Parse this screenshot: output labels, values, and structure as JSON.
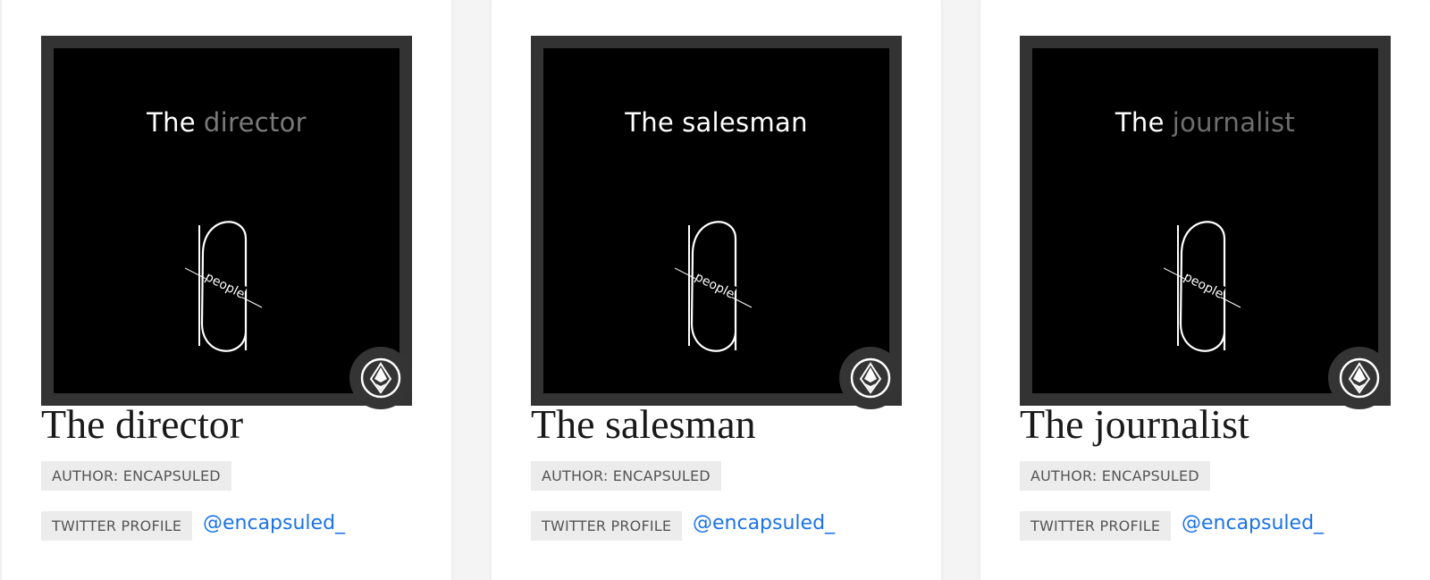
{
  "cards": [
    {
      "art_prefix": "The",
      "art_role": "director",
      "art_role_color": "#7a7a7a",
      "art_word": "people",
      "title": "The director",
      "author_tag": "AUTHOR: ENCAPSULED",
      "twitter_tag": "TWITTER PROFILE",
      "twitter_handle": "@encapsuled_",
      "badge_icon": "ethereum-icon"
    },
    {
      "art_prefix": "The",
      "art_role": "salesman",
      "art_role_color": "#ffffff",
      "art_word": "people",
      "title": "The salesman",
      "author_tag": "AUTHOR: ENCAPSULED",
      "twitter_tag": "TWITTER PROFILE",
      "twitter_handle": "@encapsuled_",
      "badge_icon": "ethereum-icon"
    },
    {
      "art_prefix": "The",
      "art_role": "journalist",
      "art_role_color": "#6e6e6e",
      "art_word": "people",
      "title": "The journalist",
      "author_tag": "AUTHOR: ENCAPSULED",
      "twitter_tag": "TWITTER PROFILE",
      "twitter_handle": "@encapsuled_",
      "badge_icon": "ethereum-icon"
    }
  ],
  "colors": {
    "link": "#1a73e8",
    "art_frame": "#333333",
    "badge_bg": "#343434"
  }
}
